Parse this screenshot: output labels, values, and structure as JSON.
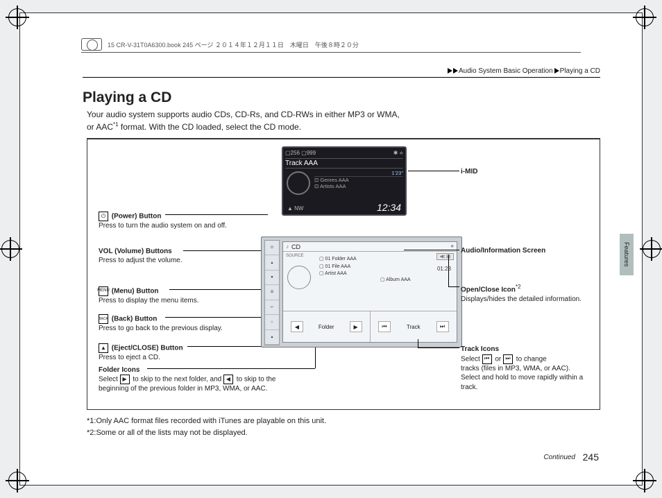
{
  "file_header": "15 CR-V-31T0A6300.book  245 ページ  ２０１４年１２月１１日　木曜日　午後８時２０分",
  "breadcrumb": {
    "a": "Audio System Basic Operation",
    "b": "Playing a CD"
  },
  "title": "Playing a CD",
  "intro_l1": "Your audio system supports audio CDs, CD-Rs, and CD-RWs in either MP3 or WMA,",
  "intro_l2": "or AAC",
  "intro_sup": "*1",
  "intro_l2b": " format. With the CD loaded, select the CD mode.",
  "left_labels": {
    "power": {
      "t": " (Power) Button",
      "d": "Press to turn the audio system on and off."
    },
    "vol": {
      "t": "VOL (Volume) Buttons",
      "d": "Press to adjust the volume."
    },
    "menu": {
      "t": " (Menu) Button",
      "d": "Press to display the menu items."
    },
    "back": {
      "t": " (Back) Button",
      "d": "Press to go back to the previous display."
    },
    "eject": {
      "t": " (Eject/CLOSE) Button",
      "d": "Press to eject a CD."
    },
    "folder": {
      "t": "Folder Icons",
      "d1": "Select ",
      "d2": " to skip to the next folder, and ",
      "d3": " to skip to the",
      "d4": "beginning of the previous folder in MP3, WMA, or AAC."
    }
  },
  "right_labels": {
    "imid": "i-MID",
    "ais": "Audio/Information Screen",
    "oc": {
      "t": "Open/Close Icon",
      "sup": "*2",
      "d": "Displays/hides the detailed information."
    },
    "tracks": {
      "t": "Track Icons",
      "d1": "Select ",
      "d2": " or ",
      "d3": " to change",
      "d4": "tracks (files in MP3, WMA, or AAC).",
      "d5": "Select and hold to move rapidly within a track."
    }
  },
  "imid": {
    "top": "▢256 ▢999",
    "bt": "✱ ⟡",
    "track": "Track AAA",
    "dur": "1'23\"",
    "l1": "⊡ Genres AAA",
    "l2": "⊡ Artists AAA",
    "nw": "▲ NW",
    "time": "12:34"
  },
  "ais": {
    "hdr": "CD",
    "src": "SOURCE",
    "oc": "≪ ⊟",
    "f1": "▢ 01 Folder AAA",
    "f2": "▢ 01 File AAA",
    "f3": "▢ Artist AAA",
    "alb": "▢ Album AAA",
    "tm": "01:23",
    "folder": "Folder",
    "track": "Track"
  },
  "footnotes": {
    "f1": "*1:Only AAC format files recorded with iTunes are playable on this unit.",
    "f2": "*2:Some or all of the lists may not be displayed."
  },
  "side_tab": "Features",
  "continued": "Continued",
  "page_number": "245"
}
